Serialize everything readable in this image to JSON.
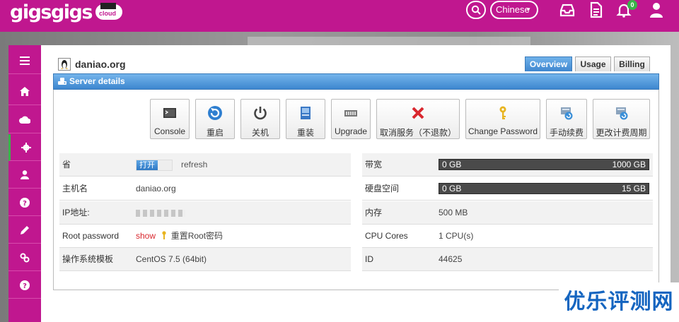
{
  "header": {
    "logo_text": "gigsgigs",
    "logo_badge": "cloud",
    "language": "Chinese",
    "notification_count": "0",
    "icons": [
      "search-icon",
      "inbox-icon",
      "document-icon",
      "bell-icon",
      "user-icon"
    ]
  },
  "sidebar": {
    "items": [
      {
        "icon": "menu-icon"
      },
      {
        "icon": "home-icon"
      },
      {
        "icon": "cloud-icon"
      },
      {
        "icon": "gear-icon",
        "active": true
      },
      {
        "icon": "user-icon"
      },
      {
        "icon": "help-icon"
      },
      {
        "icon": "pencil-icon"
      },
      {
        "icon": "link-icon"
      },
      {
        "icon": "help-icon"
      }
    ]
  },
  "server": {
    "hostname_title": "daniao.org",
    "panel_title": "Server details"
  },
  "tabs": [
    {
      "label": "Overview",
      "active": true
    },
    {
      "label": "Usage",
      "active": false
    },
    {
      "label": "Billing",
      "active": false
    }
  ],
  "actions": [
    {
      "label": "Console",
      "icon": "console-icon"
    },
    {
      "label": "重启",
      "icon": "restart-icon"
    },
    {
      "label": "关机",
      "icon": "power-icon"
    },
    {
      "label": "重装",
      "icon": "reinstall-icon"
    },
    {
      "label": "Upgrade",
      "icon": "upgrade-icon"
    },
    {
      "label": "取消服务（不退款）",
      "icon": "cancel-icon"
    },
    {
      "label": "Change Password",
      "icon": "key-icon"
    },
    {
      "label": "手动续费",
      "icon": "renew-icon"
    },
    {
      "label": "更改计费周期",
      "icon": "billing-cycle-icon"
    }
  ],
  "details_left": {
    "power": {
      "label": "省",
      "toggle": "打开",
      "refresh": "refresh"
    },
    "hostname": {
      "label": "主机名",
      "value": "daniao.org"
    },
    "ip": {
      "label": "IP地址:",
      "value": ""
    },
    "root_password": {
      "label": "Root password",
      "show": "show",
      "reset": "重置Root密码"
    },
    "os": {
      "label": "操作系统模板",
      "value": "CentOS 7.5 (64bit)"
    }
  },
  "details_right": {
    "bandwidth": {
      "label": "带宽",
      "used": "0 GB",
      "total": "1000 GB",
      "fraction": 0
    },
    "disk": {
      "label": "硬盘空间",
      "used": "0 GB",
      "total": "15 GB",
      "fraction": 0
    },
    "memory": {
      "label": "内存",
      "value": "500 MB"
    },
    "cpu": {
      "label": "CPU Cores",
      "value": "1 CPU(s)"
    },
    "id": {
      "label": "ID",
      "value": "44625"
    }
  },
  "watermark": "优乐评测网",
  "colors": {
    "brand": "#c0178f",
    "accent": "#3f87cf",
    "active_indicator": "#3ab34a",
    "danger": "#d9272e"
  }
}
